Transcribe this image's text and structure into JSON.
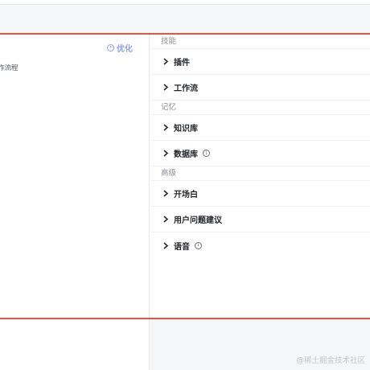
{
  "editor": {
    "optimize_label": "优化",
    "prompt_fragment": "作流程"
  },
  "skills": {
    "title": "技能",
    "items": [
      {
        "label": "插件"
      },
      {
        "label": "工作流"
      }
    ]
  },
  "memory": {
    "title": "记忆",
    "items": [
      {
        "label": "知识库"
      },
      {
        "label": "数据库"
      }
    ]
  },
  "advanced": {
    "title": "高级",
    "items": [
      {
        "label": "开场白"
      },
      {
        "label": "用户问题建议"
      },
      {
        "label": "语音"
      }
    ]
  },
  "watermark": "@稀土掘金技术社区",
  "colors": {
    "accent_highlight": "#e8553e",
    "optimize_text": "#8f9ef5"
  }
}
